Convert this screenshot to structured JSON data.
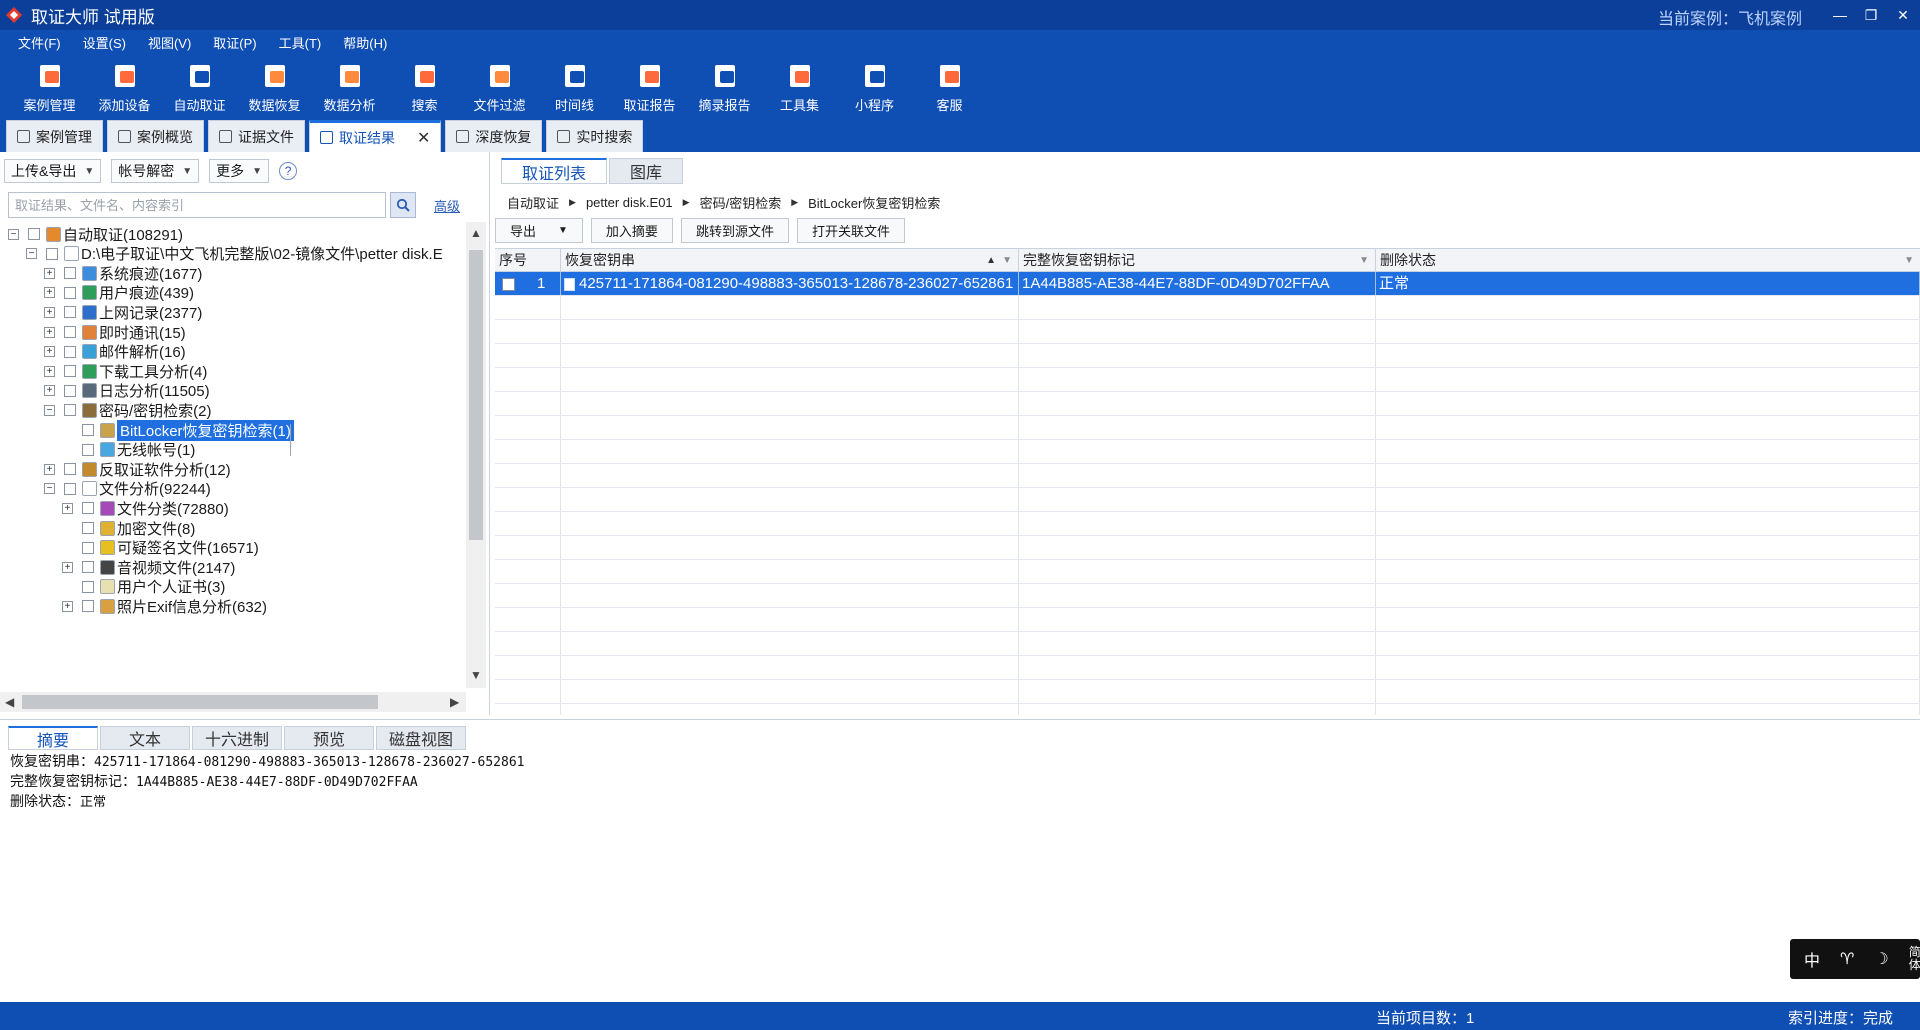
{
  "window": {
    "title": "取证大师 试用版",
    "current_case": "当前案例：飞机案例"
  },
  "menu": [
    "文件(F)",
    "设置(S)",
    "视图(V)",
    "取证(P)",
    "工具(T)",
    "帮助(H)"
  ],
  "toolbar": [
    {
      "label": "案例管理",
      "icon": "case-manage-icon",
      "color": "#ff6a3d"
    },
    {
      "label": "添加设备",
      "icon": "add-device-icon",
      "color": "#ff6a3d"
    },
    {
      "label": "自动取证",
      "icon": "auto-forensics-icon",
      "color": "#ffffff"
    },
    {
      "label": "数据恢复",
      "icon": "data-recovery-icon",
      "color": "#ff8a3d"
    },
    {
      "label": "数据分析",
      "icon": "data-analysis-icon",
      "color": "#ff8a3d"
    },
    {
      "label": "搜索",
      "icon": "search-doc-icon",
      "color": "#ff6a3d"
    },
    {
      "label": "文件过滤",
      "icon": "file-filter-icon",
      "color": "#ff8a3d"
    },
    {
      "label": "时间线",
      "icon": "timeline-icon",
      "color": "#ffffff"
    },
    {
      "label": "取证报告",
      "icon": "report-icon",
      "color": "#ff6a3d"
    },
    {
      "label": "摘录报告",
      "icon": "excerpt-report-icon",
      "color": "#ffffff"
    },
    {
      "label": "工具集",
      "icon": "toolset-icon",
      "color": "#ff6a3d"
    },
    {
      "label": "小程序",
      "icon": "mini-program-icon",
      "color": "#ffffff"
    },
    {
      "label": "客服",
      "icon": "customer-service-icon",
      "color": "#ff6a3d"
    }
  ],
  "tabs": [
    {
      "label": "案例管理",
      "active": false
    },
    {
      "label": "案例概览",
      "active": false
    },
    {
      "label": "证据文件",
      "active": false
    },
    {
      "label": "取证结果",
      "active": true
    },
    {
      "label": "深度恢复",
      "active": false
    },
    {
      "label": "实时搜索",
      "active": false
    }
  ],
  "left": {
    "dropdowns": [
      "上传&导出",
      "帐号解密",
      "更多"
    ],
    "help": "?",
    "search_placeholder": "取证结果、文件名、内容索引",
    "advanced": "高级"
  },
  "tree": [
    {
      "label": "自动取证(108291)",
      "exp": "−",
      "level": 0,
      "icon_color": "#e58a2c"
    },
    {
      "label": "D:\\电子取证\\中文飞机完整版\\02-镜像文件\\petter disk.E",
      "exp": "−",
      "level": 1,
      "icon_color": "#ffffff"
    },
    {
      "label": "系统痕迹(1677)",
      "exp": "+",
      "level": 2,
      "icon_color": "#3c8dde"
    },
    {
      "label": "用户痕迹(439)",
      "exp": "+",
      "level": 2,
      "icon_color": "#2f9e5b"
    },
    {
      "label": "上网记录(2377)",
      "exp": "+",
      "level": 2,
      "icon_color": "#2f6fcc"
    },
    {
      "label": "即时通讯(15)",
      "exp": "+",
      "level": 2,
      "icon_color": "#e0823a"
    },
    {
      "label": "邮件解析(16)",
      "exp": "+",
      "level": 2,
      "icon_color": "#3aa0d8"
    },
    {
      "label": "下载工具分析(4)",
      "exp": "+",
      "level": 2,
      "icon_color": "#2f9e5b"
    },
    {
      "label": "日志分析(11505)",
      "exp": "+",
      "level": 2,
      "icon_color": "#5a6a7d"
    },
    {
      "label": "密码/密钥检索(2)",
      "exp": "−",
      "level": 2,
      "icon_color": "#8a6d3b"
    },
    {
      "label": "BitLocker恢复密钥检索(1)",
      "exp": "",
      "level": 3,
      "icon_color": "#c9a24a",
      "selected": true
    },
    {
      "label": "无线帐号(1)",
      "exp": "",
      "level": 3,
      "icon_color": "#4aa8e0"
    },
    {
      "label": "反取证软件分析(12)",
      "exp": "+",
      "level": 2,
      "icon_color": "#c28a2c"
    },
    {
      "label": "文件分析(92244)",
      "exp": "−",
      "level": 2,
      "icon_color": "#ffffff"
    },
    {
      "label": "文件分类(72880)",
      "exp": "+",
      "level": 3,
      "icon_color": "#a64ab8"
    },
    {
      "label": "加密文件(8)",
      "exp": "",
      "level": 3,
      "icon_color": "#e0b030"
    },
    {
      "label": "可疑签名文件(16571)",
      "exp": "",
      "level": 3,
      "icon_color": "#e6c020"
    },
    {
      "label": "音视频文件(2147)",
      "exp": "+",
      "level": 3,
      "icon_color": "#444444"
    },
    {
      "label": "用户个人证书(3)",
      "exp": "",
      "level": 3,
      "icon_color": "#e8e0b0"
    },
    {
      "label": "照片Exif信息分析(632)",
      "exp": "+",
      "level": 3,
      "icon_color": "#d8a040"
    }
  ],
  "right": {
    "tabs": [
      {
        "label": "取证列表",
        "active": true
      },
      {
        "label": "图库",
        "active": false
      }
    ],
    "breadcrumb": [
      "自动取证",
      "petter disk.E01",
      "密码/密钥检索",
      "BitLocker恢复密钥检索"
    ],
    "actions": [
      "导出",
      "加入摘要",
      "跳转到源文件",
      "打开关联文件"
    ],
    "columns": [
      "序号",
      "恢复密钥串",
      "完整恢复密钥标记",
      "删除状态"
    ],
    "rows": [
      {
        "index": "1",
        "key": "425711-171864-081290-498883-365013-128678-236027-652861",
        "id": "1A44B885-AE38-44E7-88DF-0D49D702FFAA",
        "status": "正常"
      }
    ],
    "empty_row_count": 18
  },
  "bottom": {
    "tabs": [
      "摘要",
      "文本",
      "十六进制",
      "预览",
      "磁盘视图"
    ],
    "summary": [
      {
        "key": "恢复密钥串：",
        "value": "425711-171864-081290-498883-365013-128678-236027-652861"
      },
      {
        "key": "完整恢复密钥标记：",
        "value": "1A44B885-AE38-44E7-88DF-0D49D702FFAA"
      },
      {
        "key": "删除状态：",
        "value": "正常"
      }
    ]
  },
  "ime": {
    "items": [
      "中",
      "♈",
      "☽"
    ],
    "vertical": "简 体"
  },
  "status": {
    "current_count": "当前项目数：1",
    "index_progress": "索引进度：完成"
  }
}
